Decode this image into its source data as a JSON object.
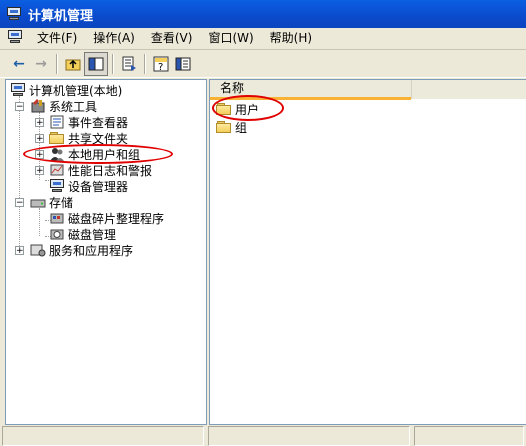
{
  "window": {
    "title": "计算机管理",
    "title_icon": "computer-management-icon"
  },
  "menu": [
    {
      "label": "文件(F)"
    },
    {
      "label": "操作(A)"
    },
    {
      "label": "查看(V)"
    },
    {
      "label": "窗口(W)"
    },
    {
      "label": "帮助(H)"
    }
  ],
  "toolbar": {
    "back": "←",
    "forward": "→",
    "buttons": [
      "up-folder-icon",
      "show-hide-tree-icon",
      "export-list-icon",
      "help-icon",
      "properties-icon"
    ]
  },
  "tree": {
    "root": "计算机管理(本地)",
    "system_tools": "系统工具",
    "event_viewer": "事件查看器",
    "shared_folders": "共享文件夹",
    "local_users_groups": "本地用户和组",
    "performance_logs": "性能日志和警报",
    "device_manager": "设备管理器",
    "storage": "存储",
    "defrag": "磁盘碎片整理程序",
    "disk_mgmt": "磁盘管理",
    "services_apps": "服务和应用程序"
  },
  "list": {
    "column_name": "名称",
    "items": [
      {
        "label": "用户",
        "icon": "folder-icon"
      },
      {
        "label": "组",
        "icon": "folder-icon"
      }
    ]
  },
  "annotation_color": "#e00000"
}
